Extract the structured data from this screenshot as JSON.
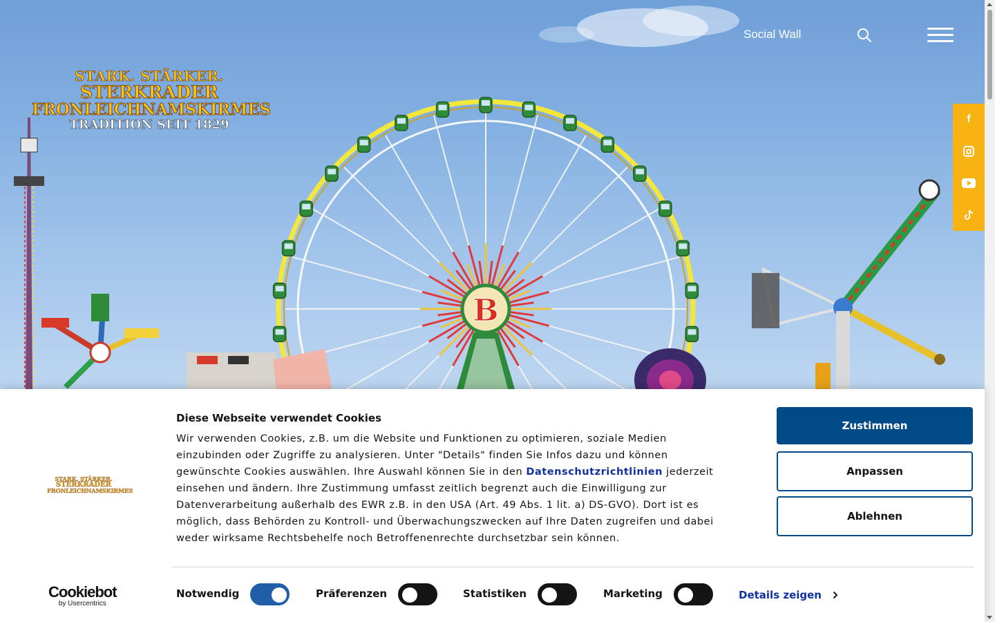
{
  "header": {
    "social_wall_label": "Social Wall",
    "search_icon": "search-icon",
    "menu_icon": "hamburger-menu-icon"
  },
  "logo": {
    "line1": "STARK. STÄRKER.",
    "line2": "STERKRADER",
    "line3": "FRONLEICHNAMSKIRMES",
    "line4": "TRADITION SEIT 1829"
  },
  "social": {
    "items": [
      {
        "label": "f",
        "icon": "facebook-icon"
      },
      {
        "label": "",
        "icon": "instagram-icon"
      },
      {
        "label": "",
        "icon": "youtube-icon"
      },
      {
        "label": "",
        "icon": "tiktok-icon"
      }
    ]
  },
  "cookie_banner": {
    "title": "Diese Webseite verwendet Cookies",
    "text_part1": "Wir verwenden Cookies, z.B. um die Website und Funktionen zu optimieren, soziale Medien einzubinden oder Zugriffe zu analysieren. Unter \"Details\" finden Sie Infos dazu und können gewünschte Cookies auswählen. Ihre Auswahl können Sie in den ",
    "privacy_link": "Datenschutzrichtlinien",
    "text_part2": " jederzeit einsehen und ändern. Ihre Zustimmung umfasst zeitlich begrenzt auch die Einwilligung zur Datenverarbeitung außerhalb des EWR z.B. in den USA (Art. 49 Abs. 1 lit. a) DS-GVO). Dort ist es möglich, dass Behörden zu Kontroll- und Überwachungszwecken auf Ihre Daten zugreifen und dabei weder wirksame Rechtsbehelfe noch Betroffenenrechte durchsetzbar sein können.",
    "accept_label": "Zustimmen",
    "customize_label": "Anpassen",
    "decline_label": "Ablehnen",
    "toggles": [
      {
        "label": "Notwendig",
        "on": true
      },
      {
        "label": "Präferenzen",
        "on": false
      },
      {
        "label": "Statistiken",
        "on": false
      },
      {
        "label": "Marketing",
        "on": false
      }
    ],
    "details_label": "Details zeigen",
    "brand_name": "Cookiebot",
    "brand_sub": "by Usercentrics",
    "small_logo": {
      "line1": "STARK. STÄRKER.",
      "line2": "STERKRADER",
      "line3": "FRONLEICHNAMSKIRMES"
    }
  },
  "colors": {
    "accent": "#004b87",
    "social_bar": "#f6b312",
    "link": "#1032a0",
    "toggle_on": "#1f5fa8"
  }
}
